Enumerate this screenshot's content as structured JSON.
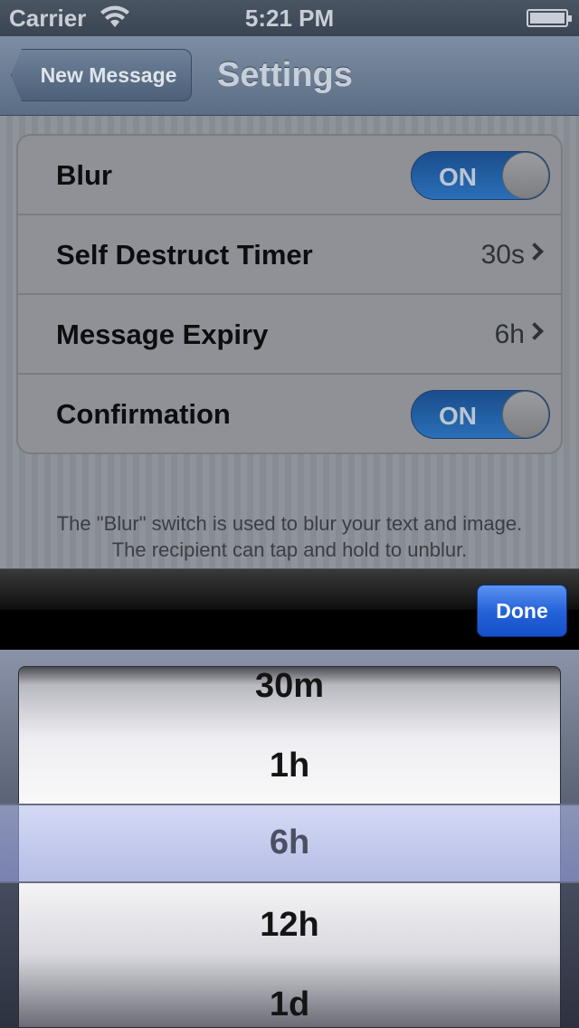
{
  "status_bar": {
    "carrier": "Carrier",
    "time": "5:21 PM"
  },
  "nav": {
    "back_label": "New Message",
    "title": "Settings"
  },
  "settings": {
    "rows": [
      {
        "label": "Blur",
        "type": "switch",
        "switch_text": "ON"
      },
      {
        "label": "Self Destruct Timer",
        "type": "value",
        "value": "30s"
      },
      {
        "label": "Message Expiry",
        "type": "value",
        "value": "6h"
      },
      {
        "label": "Confirmation",
        "type": "switch",
        "switch_text": "ON"
      }
    ],
    "footer_line1": "The \"Blur\" switch is used to blur your text and image.",
    "footer_line2": "The recipient can tap and hold to unblur."
  },
  "toolbar": {
    "done_label": "Done"
  },
  "picker": {
    "options": [
      "30m",
      "1h",
      "6h",
      "12h",
      "1d"
    ],
    "selected": "6h"
  },
  "colors": {
    "accent": "#2563d9",
    "switch_on": "#2a6fb8"
  }
}
